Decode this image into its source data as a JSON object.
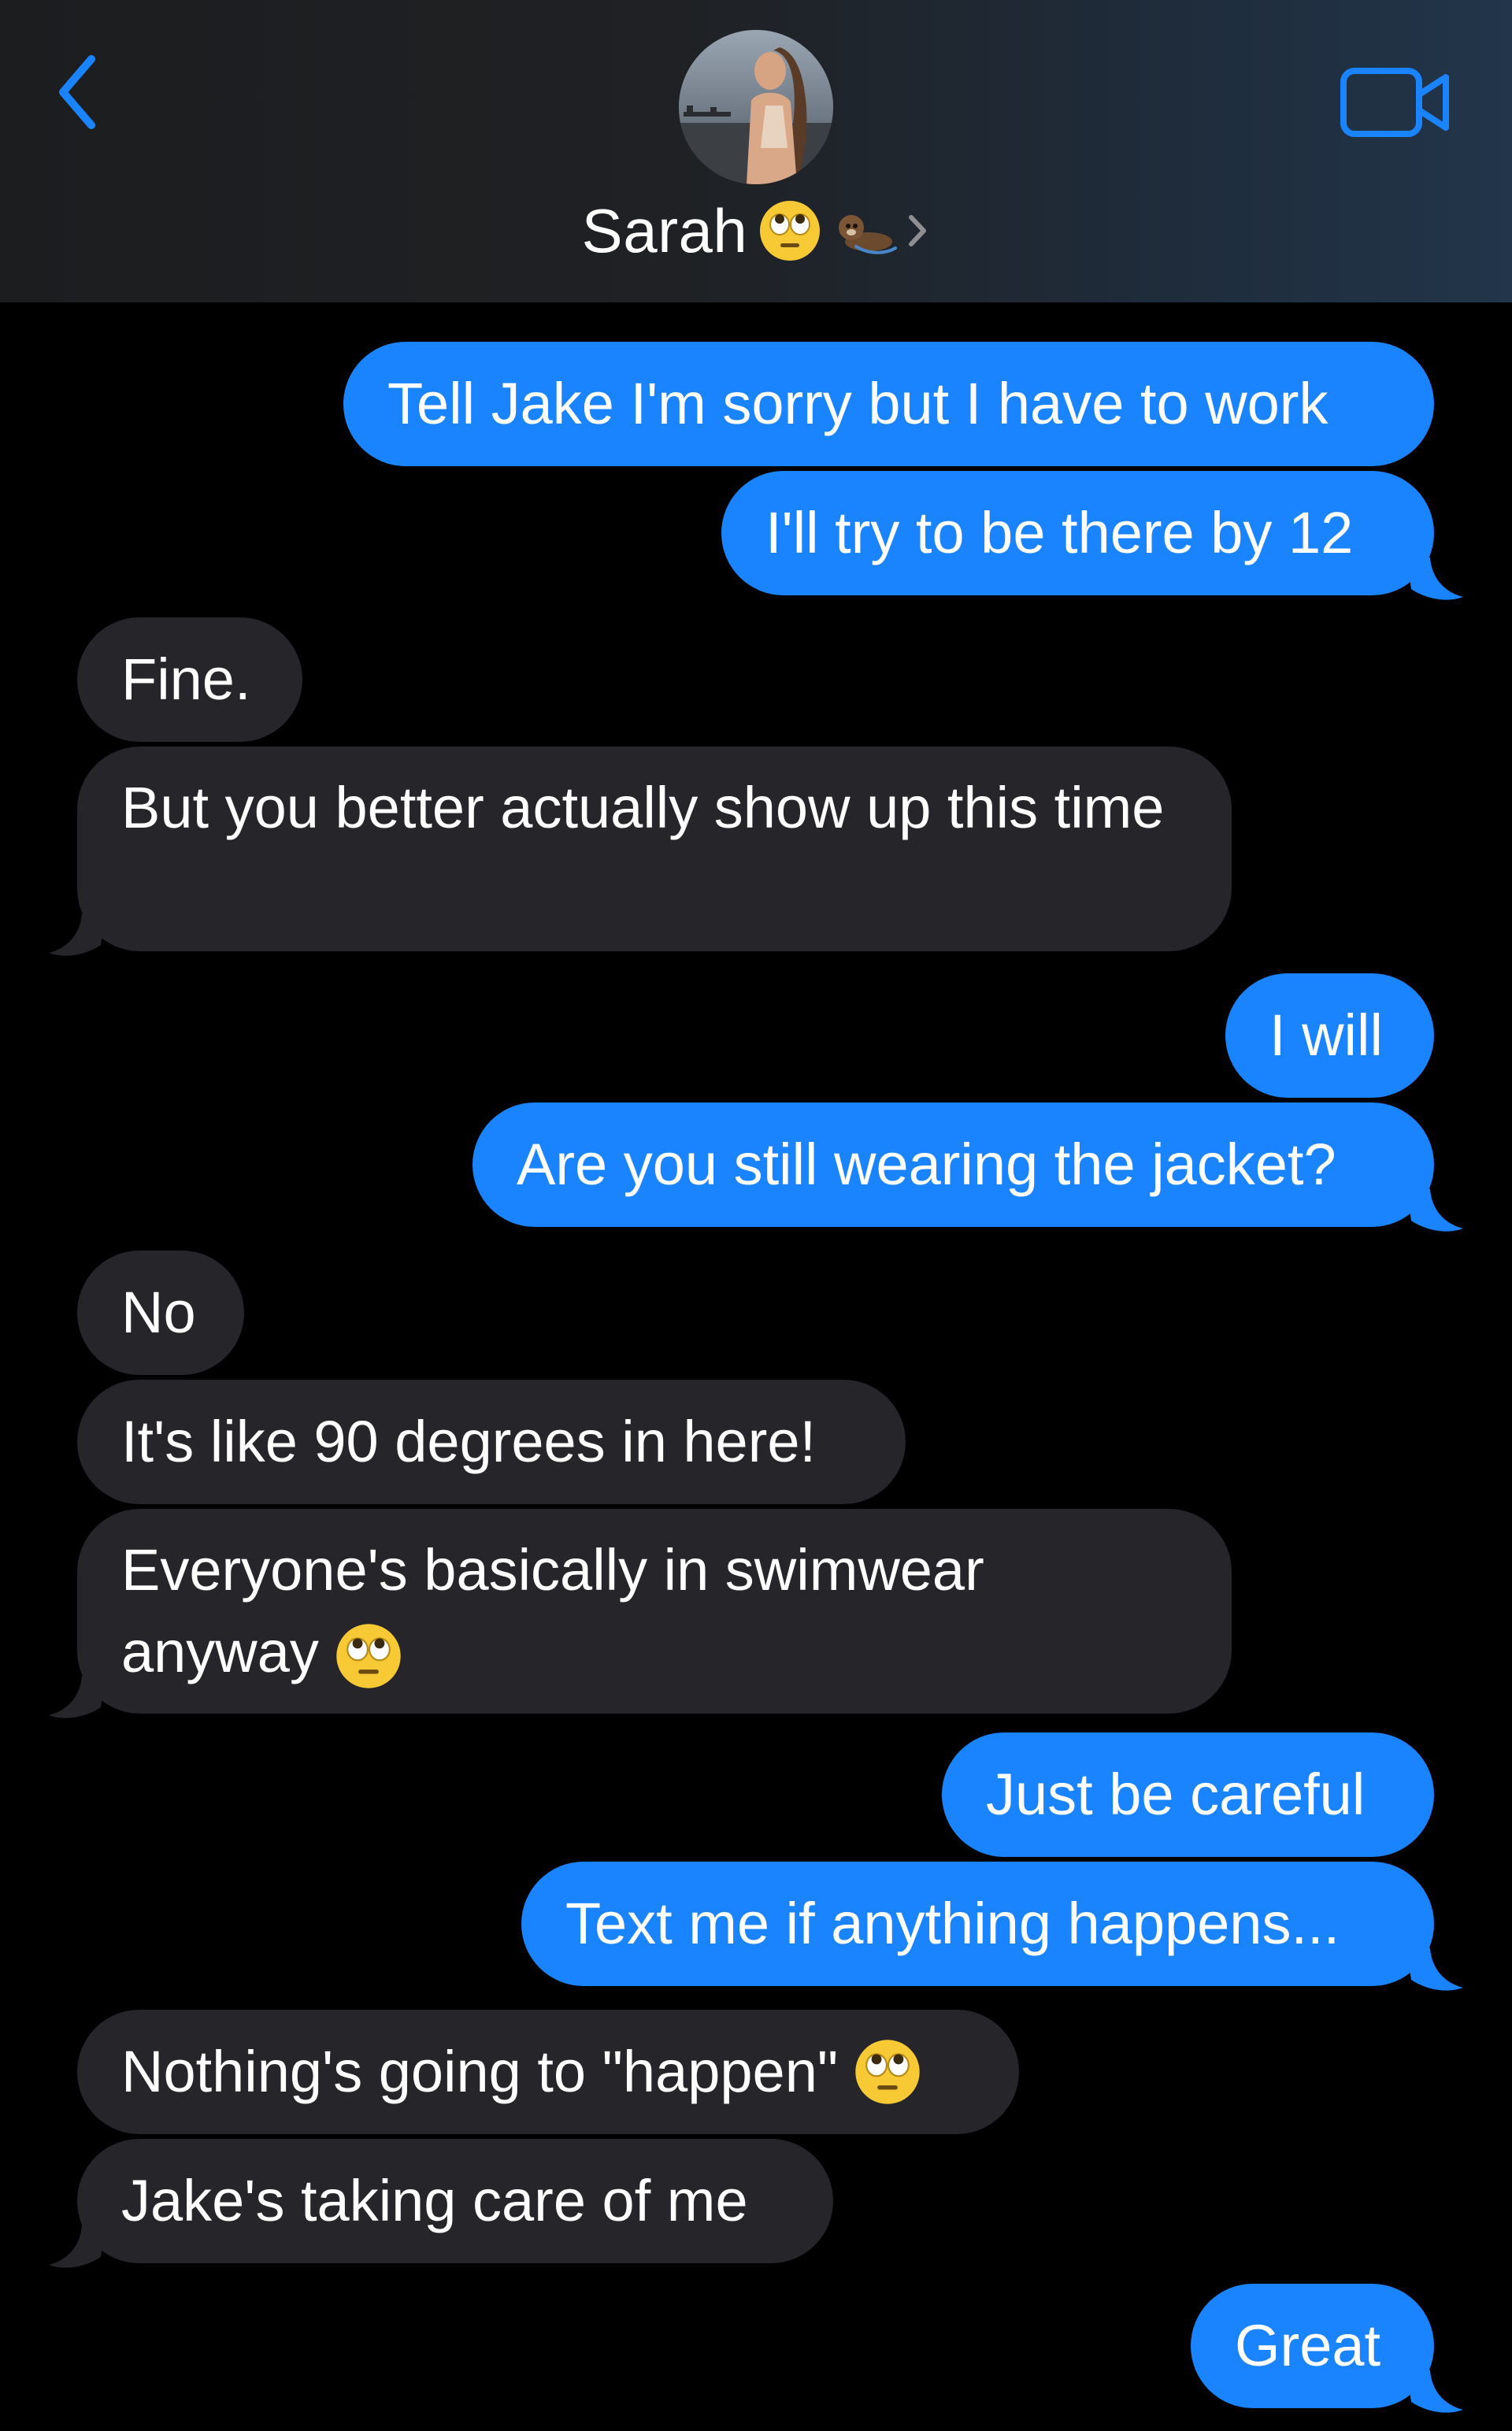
{
  "header": {
    "contact_name": "Sarah",
    "name_emoji": "face-with-rolling-eyes",
    "name_emoji_2": "otter",
    "back_icon": "chevron-left-icon",
    "video_icon": "video-camera-icon",
    "accent_color": "#1a84ff"
  },
  "messages": [
    {
      "from": "me",
      "text": "Tell Jake I'm sorry but I have to work"
    },
    {
      "from": "me",
      "text": "I'll try to be there by 12"
    },
    {
      "from": "sarah",
      "text": "Fine."
    },
    {
      "from": "sarah",
      "text": "But you better actually show up this time"
    },
    {
      "from": "me",
      "text": "I will"
    },
    {
      "from": "me",
      "text": "Are you still wearing the jacket?"
    },
    {
      "from": "sarah",
      "text": "No"
    },
    {
      "from": "sarah",
      "text": "It's like 90 degrees in here!"
    },
    {
      "from": "sarah",
      "text": "Everyone's basically in swimwear anyway",
      "emoji": "face-with-rolling-eyes"
    },
    {
      "from": "me",
      "text": "Just be careful"
    },
    {
      "from": "me",
      "text": "Text me if anything happens..."
    },
    {
      "from": "sarah",
      "text": "Nothing's going to \"happen\"",
      "emoji": "face-with-rolling-eyes"
    },
    {
      "from": "sarah",
      "text": "Jake's taking care of me"
    },
    {
      "from": "me",
      "text": "Great"
    }
  ],
  "colors": {
    "sent_bubble": "#1a84ff",
    "received_bubble": "#26262a",
    "background": "#000000"
  }
}
